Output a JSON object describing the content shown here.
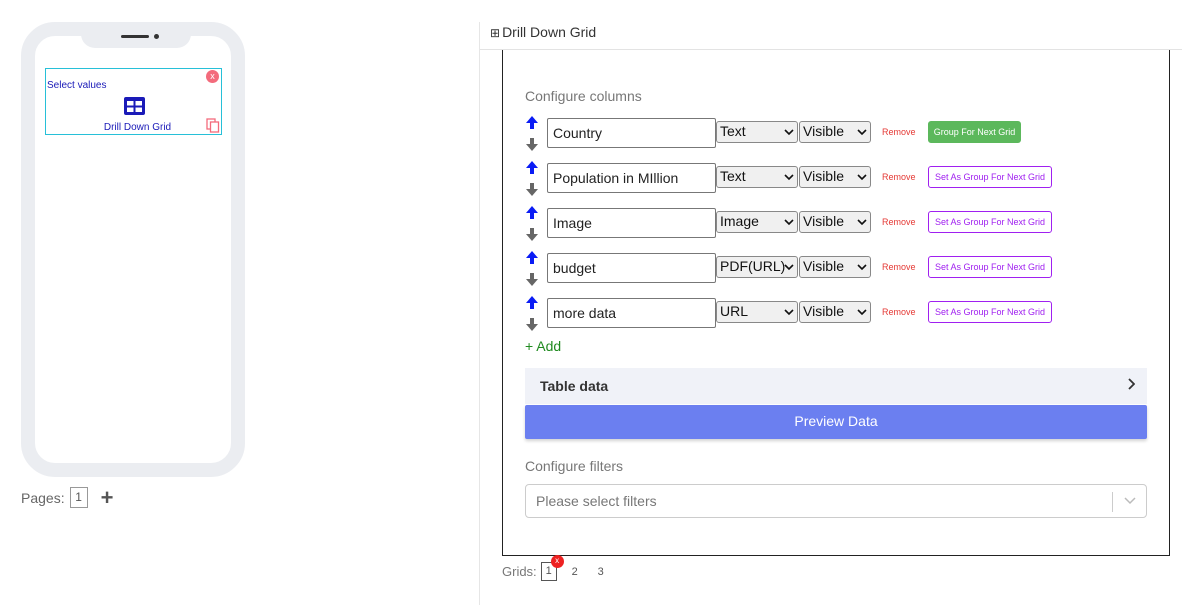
{
  "left": {
    "widget": {
      "select_label": "Select values",
      "title": "Drill Down Grid",
      "close_glyph": "x",
      "icon": "table-grid-icon"
    },
    "pages": {
      "label": "Pages:",
      "current": "1",
      "add_glyph": "+"
    }
  },
  "panel": {
    "header_icon": "⊞",
    "header_title": "Drill Down Grid",
    "configure_columns_label": "Configure columns",
    "columns": [
      {
        "name": "Country",
        "type": "Text",
        "visibility": "Visible",
        "remove_label": "Remove",
        "group_label": "Group For Next Grid",
        "group_active": true
      },
      {
        "name": "Population in MIllion",
        "type": "Text",
        "visibility": "Visible",
        "remove_label": "Remove",
        "group_label": "Set As Group For Next Grid",
        "group_active": false
      },
      {
        "name": "Image",
        "type": "Image",
        "visibility": "Visible",
        "remove_label": "Remove",
        "group_label": "Set As Group For Next Grid",
        "group_active": false
      },
      {
        "name": "budget",
        "type": "PDF(URL)",
        "visibility": "Visible",
        "remove_label": "Remove",
        "group_label": "Set As Group For Next Grid",
        "group_active": false
      },
      {
        "name": "more data",
        "type": "URL",
        "visibility": "Visible",
        "remove_label": "Remove",
        "group_label": "Set As Group For Next Grid",
        "group_active": false
      }
    ],
    "add_label": "+ Add",
    "table_data_label": "Table data",
    "preview_button": "Preview Data",
    "configure_filters_label": "Configure filters",
    "filters_placeholder": "Please select filters",
    "grids": {
      "label": "Grids:",
      "tabs": [
        "1",
        "2",
        "3"
      ],
      "active": "1",
      "delete_glyph": "x"
    }
  },
  "colors": {
    "accent": "#6b7ff0",
    "group_active": "#5cb85c",
    "group_outline": "#a020f0",
    "remove": "#e53935",
    "arrow_up": "#0a1cf5",
    "widget_text": "#1a1ab8",
    "widget_border": "#27c0d8"
  }
}
